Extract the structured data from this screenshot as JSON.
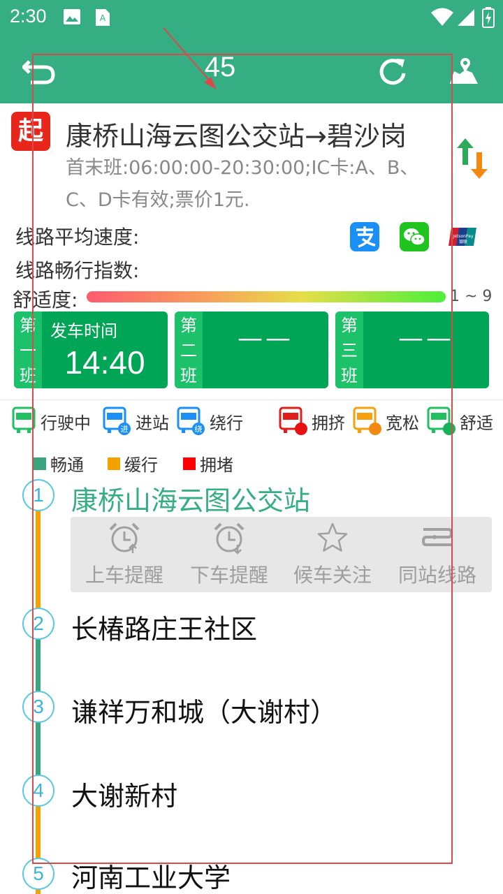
{
  "status_bar": {
    "time": "2:30"
  },
  "toolbar": {
    "title": "45"
  },
  "route": {
    "badge": "起",
    "name": "康桥山海云图公交站→碧沙岗",
    "info": "首末班:06:00:00-20:30:00;IC卡:A、B、C、D卡有效;票价1元."
  },
  "metrics": {
    "avg_speed_label": "线路平均速度:",
    "flow_index_label": "线路畅行指数:",
    "comfort_label": "舒适度:",
    "comfort_range": "1 ~ 9"
  },
  "payments": {
    "union_text_top": "JetsonPay",
    "union_text_bottom": "银联"
  },
  "shifts": [
    {
      "side": [
        "第",
        "一",
        "班"
      ],
      "label": "发车时间",
      "value": "14:40"
    },
    {
      "side": [
        "第",
        "二",
        "班"
      ],
      "label": "",
      "value": "——"
    },
    {
      "side": [
        "第",
        "三",
        "班"
      ],
      "label": "",
      "value": "——"
    }
  ],
  "bus_legend": [
    {
      "label": "行驶中",
      "icon": "bus-running-icon",
      "badge": ""
    },
    {
      "label": "进站",
      "icon": "bus-arriving-icon",
      "badge": "进"
    },
    {
      "label": "绕行",
      "icon": "bus-detour-icon",
      "badge": "绕"
    },
    {
      "label": "拥挤",
      "icon": "bus-crowded-icon",
      "badge": ""
    },
    {
      "label": "宽松",
      "icon": "bus-loose-icon",
      "badge": ""
    },
    {
      "label": "舒适",
      "icon": "bus-comfortable-icon",
      "badge": ""
    }
  ],
  "traffic_legend": [
    {
      "label": "畅通",
      "color": "#3aa57c"
    },
    {
      "label": "缓行",
      "color": "#f3a300"
    },
    {
      "label": "拥堵",
      "color": "#ff0000"
    }
  ],
  "stops": [
    {
      "num": "1",
      "name": "康桥山海云图公交站"
    },
    {
      "num": "2",
      "name": "长椿路庄王社区"
    },
    {
      "num": "3",
      "name": "谦祥万和城（大谢村）"
    },
    {
      "num": "4",
      "name": "大谢新村"
    },
    {
      "num": "5",
      "name": "河南工业大学"
    }
  ],
  "actions": [
    {
      "label": "上车提醒",
      "icon": "alarm-up-icon"
    },
    {
      "label": "下车提醒",
      "icon": "alarm-down-icon"
    },
    {
      "label": "候车关注",
      "icon": "star-icon"
    },
    {
      "label": "同站线路",
      "icon": "route-icon"
    }
  ],
  "colors": {
    "primary": "#34ae82",
    "shift_green": "#00a555",
    "badge_red": "#e8261c"
  }
}
